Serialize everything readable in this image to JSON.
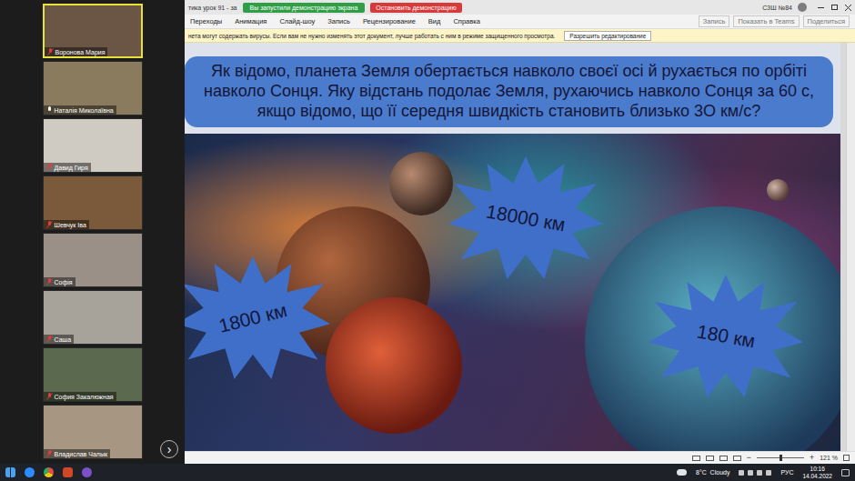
{
  "participants": [
    {
      "name": "Воронова Мария",
      "muted": true,
      "selected": true
    },
    {
      "name": "Наталія Миколаївна",
      "muted": false,
      "selected": false
    },
    {
      "name": "Давид Гиря",
      "muted": true,
      "selected": false
    },
    {
      "name": "Шевчук Іва",
      "muted": true,
      "selected": false
    },
    {
      "name": "Софія",
      "muted": true,
      "selected": false
    },
    {
      "name": "Саша",
      "muted": true,
      "selected": false
    },
    {
      "name": "София Закалюжная",
      "muted": true,
      "selected": false
    },
    {
      "name": "Владислав Чалык",
      "muted": true,
      "selected": false
    }
  ],
  "nav_button": "›",
  "titlebar": {
    "doc": "тика урок 91 - за",
    "share_notice": "Вы запустили демонстрацию экрана",
    "stop_share": "Остановить демонстрацию",
    "account": "СЗШ №84",
    "buttons": [
      "Запись",
      "Показать в Teams",
      "Поделиться"
    ]
  },
  "menu": [
    "Переходы",
    "Анимация",
    "Слайд-шоу",
    "Запись",
    "Рецензирование",
    "Вид",
    "Справка"
  ],
  "protected_bar": {
    "message": "нета могут содержать вирусы. Если вам не нужно изменять этот документ, лучше работать с ним в режиме защищенного просмотра.",
    "button": "Разрешить редактирование"
  },
  "slide": {
    "question": "Як відомо, планета Земля обертається навколо своєї осі й рухається по орбіті навколо Сонця. Яку відстань подолає Земля, рухаючись навколо Сонця за 60 с, якщо відомо, що її середня швидкість становить близько 3О км/с?",
    "answers": [
      "18000 км",
      "1800 км",
      "180 км"
    ]
  },
  "status_bar": {
    "zoom": "121 %",
    "zoom_level": 0.5
  },
  "taskbar": {
    "weather": "8°C  Cloudy",
    "lang": "РУС",
    "time": "10:16",
    "date": "14.04.2022"
  }
}
